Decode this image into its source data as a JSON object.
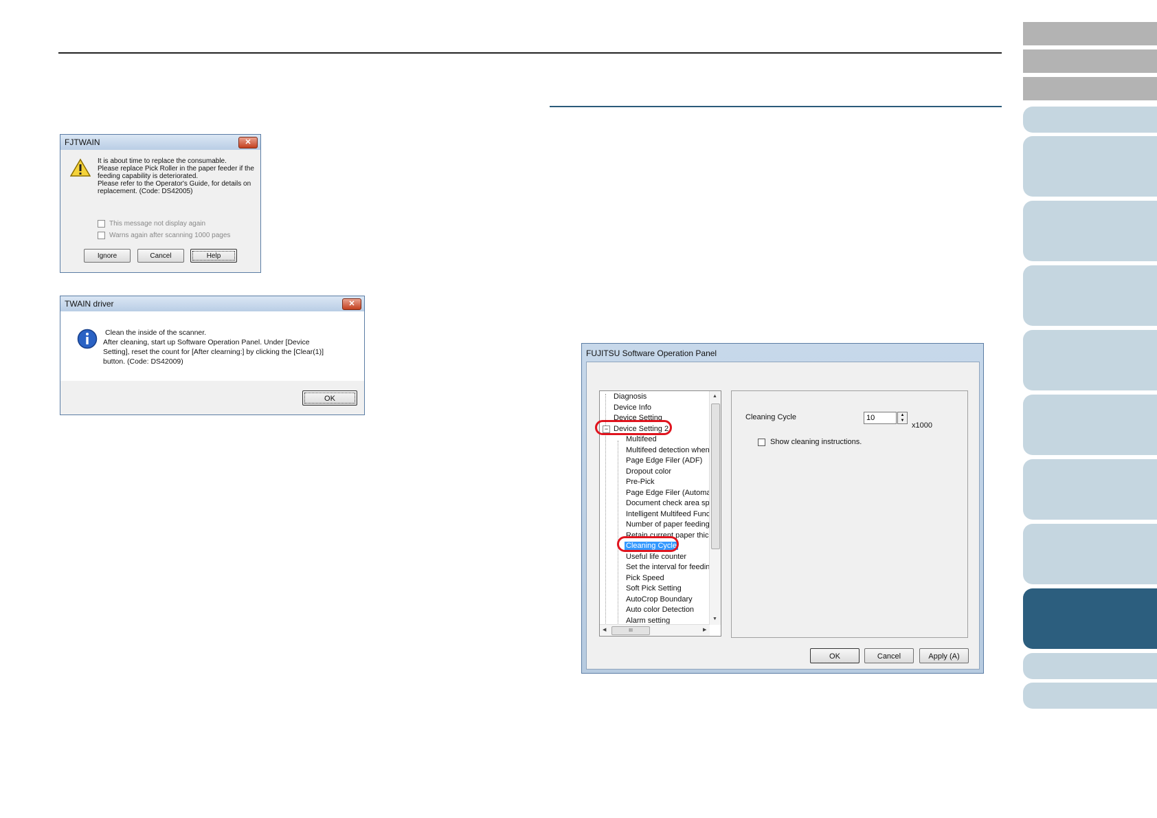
{
  "dialog1": {
    "title": "FJTWAIN",
    "close": "✕",
    "message": [
      "It is about time to replace the consumable.",
      "Please replace Pick Roller in the paper feeder if the",
      "feeding capability is deteriorated.",
      "Please refer to the Operator's Guide, for details on",
      "replacement. (Code: DS42005)"
    ],
    "checkboxes": [
      "This message not display again",
      "Warns again after scanning 1000 pages"
    ],
    "buttons": {
      "ignore": "Ignore",
      "cancel": "Cancel",
      "help": "Help"
    }
  },
  "dialog2": {
    "title": "TWAIN driver",
    "close": "✕",
    "message": [
      "Clean the inside of the scanner.",
      "After cleaning, start up Software Operation Panel. Under [Device",
      "Setting], reset the count for [After clearning:] by clicking the [Clear(1)]",
      "button. (Code: DS42009)"
    ],
    "ok": "OK"
  },
  "panel": {
    "title": "FUJITSU Software Operation Panel",
    "tree": [
      "Diagnosis",
      "Device Info",
      "Device Setting",
      "Device Setting 2",
      "Multifeed",
      "Multifeed detection when s",
      "Page Edge Filer (ADF)",
      "Dropout color",
      "Pre-Pick",
      "Page Edge Filer (Automatic",
      "Document check area spe",
      "Intelligent Multifeed Functio",
      "Number of paper feeding re",
      "Retain current paper thickn",
      "Cleaning Cycle",
      "Useful life counter",
      "Set the interval for feeding",
      "Pick Speed",
      "Soft Pick Setting",
      "AutoCrop Boundary",
      "Auto color Detection",
      "Alarm setting"
    ],
    "tree_expander": "−",
    "scroll_thumb": "III",
    "cleaning_cycle_label": "Cleaning Cycle",
    "cleaning_cycle_value": "10",
    "unit": "x1000",
    "show_instructions": "Show cleaning instructions.",
    "buttons": {
      "ok": "OK",
      "cancel": "Cancel",
      "apply": "Apply (A)"
    }
  }
}
